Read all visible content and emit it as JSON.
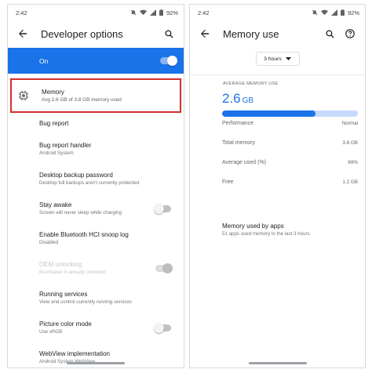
{
  "left": {
    "status": {
      "time": "2:42",
      "battery": "92%"
    },
    "toolbar": {
      "title": "Developer options"
    },
    "master": {
      "label": "On",
      "enabled": true
    },
    "memory": {
      "title": "Memory",
      "subtitle": "Avg 2.6 GB of 3.8 GB memory used"
    },
    "items": [
      {
        "title": "Bug report",
        "subtitle": ""
      },
      {
        "title": "Bug report handler",
        "subtitle": "Android System"
      },
      {
        "title": "Desktop backup password",
        "subtitle": "Desktop full backups aren't currently protected"
      },
      {
        "title": "Stay awake",
        "subtitle": "Screen will never sleep while charging",
        "toggle": "off"
      },
      {
        "title": "Enable Bluetooth HCI snoop log",
        "subtitle": "Disabled"
      },
      {
        "title": "OEM unlocking",
        "subtitle": "Bootloader is already unlocked",
        "toggle": "disabled",
        "dim": true
      },
      {
        "title": "Running services",
        "subtitle": "View and control currently running services"
      },
      {
        "title": "Picture color mode",
        "subtitle": "Use sRGB",
        "toggle": "off"
      },
      {
        "title": "WebView implementation",
        "subtitle": "Android System WebView"
      }
    ]
  },
  "right": {
    "status": {
      "time": "2:42",
      "battery": "92%"
    },
    "toolbar": {
      "title": "Memory use"
    },
    "period": {
      "selected": "3 hours"
    },
    "average": {
      "heading": "AVERAGE MEMORY USE",
      "value": "2.6",
      "unit": "GB",
      "fraction_used": 0.69
    },
    "stats": [
      {
        "label": "Performance",
        "value": "Normal"
      },
      {
        "label": "Total memory",
        "value": "3.8 GB"
      },
      {
        "label": "Average used (%)",
        "value": "69%"
      },
      {
        "label": "Free",
        "value": "1.2 GB"
      }
    ],
    "apps": {
      "title": "Memory used by apps",
      "subtitle": "51 apps used memory in the last 3 hours"
    }
  },
  "colors": {
    "accent": "#1a73e8",
    "highlight_border": "#d32f2f"
  }
}
